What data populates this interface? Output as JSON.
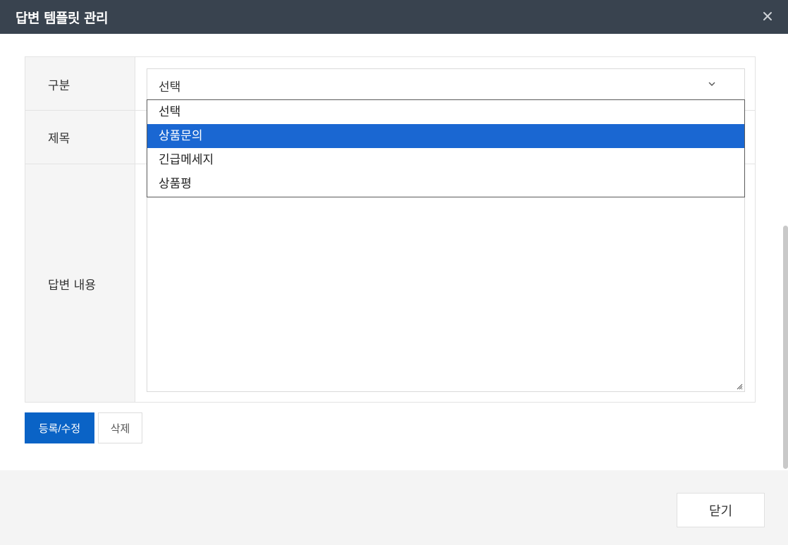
{
  "modal": {
    "title": "답변 템플릿 관리",
    "close_icon": "close-icon"
  },
  "form": {
    "category_label": "구분",
    "category_value": "선택",
    "title_label": "제목",
    "title_value": "",
    "content_label": "답변 내용",
    "content_value": ""
  },
  "dropdown": {
    "options": [
      "선택",
      "상품문의",
      "긴급메세지",
      "상품평"
    ],
    "highlighted": "상품문의"
  },
  "actions": {
    "save_label": "등록/수정",
    "delete_label": "삭제"
  },
  "footer": {
    "close_label": "닫기"
  },
  "colors": {
    "header_bg": "#39434f",
    "primary": "#0a63c6",
    "highlight": "#1a67d2",
    "label_bg": "#f5f5f5",
    "footer_bg": "#f4f4f4"
  }
}
